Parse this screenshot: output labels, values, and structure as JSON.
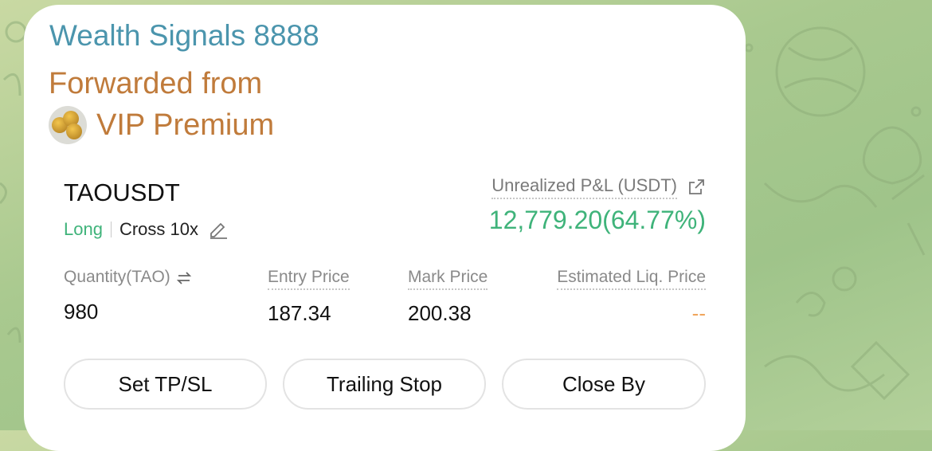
{
  "message": {
    "sender": "Wealth Signals 8888",
    "forwarded_label": "Forwarded from",
    "forwarded_source": "VIP Premium"
  },
  "position": {
    "symbol": "TAOUSDT",
    "side": "Long",
    "margin_mode": "Cross 10x",
    "pnl_label": "Unrealized P&L (USDT)",
    "pnl_value": "12,779.20(64.77%)",
    "stats": [
      {
        "label": "Quantity(TAO)",
        "value": "980"
      },
      {
        "label": "Entry Price",
        "value": "187.34"
      },
      {
        "label": "Mark Price",
        "value": "200.38"
      },
      {
        "label": "Estimated Liq. Price",
        "value": "--"
      }
    ]
  },
  "actions": {
    "set_tpsl": "Set TP/SL",
    "trailing_stop": "Trailing Stop",
    "close_by": "Close By"
  },
  "colors": {
    "sender": "#4b95ad",
    "forwarded": "#c07b3b",
    "profit": "#3fb37a",
    "liq_placeholder": "#f0a55c"
  },
  "icons": [
    "coin-avatar-icon",
    "edit-pencil-icon",
    "share-external-icon",
    "swap-arrows-icon"
  ]
}
